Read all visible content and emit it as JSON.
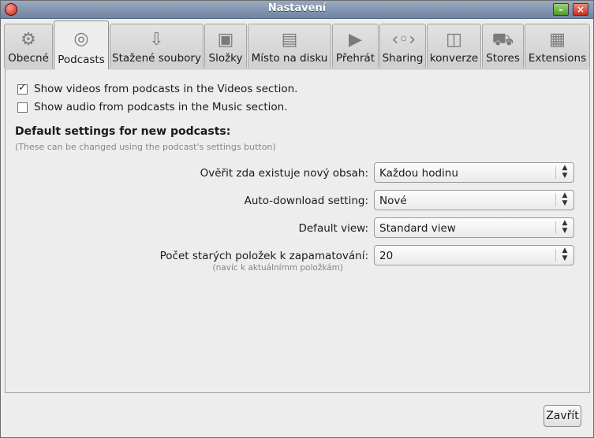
{
  "window": {
    "title": "Nastavení"
  },
  "tabs": [
    {
      "label": "Obecné",
      "icon": "gears-icon",
      "glyph": "⚙"
    },
    {
      "label": "Podcasts",
      "icon": "podcast-icon",
      "glyph": "◎"
    },
    {
      "label": "Stažené soubory",
      "icon": "download-arrow-icon",
      "glyph": "⇩"
    },
    {
      "label": "Složky",
      "icon": "folder-icon",
      "glyph": "▣"
    },
    {
      "label": "Místo na disku",
      "icon": "hard-disk-icon",
      "glyph": "▤"
    },
    {
      "label": "Přehrát",
      "icon": "play-icon",
      "glyph": "▶"
    },
    {
      "label": "Sharing",
      "icon": "sharing-icon",
      "glyph": "‹◦›"
    },
    {
      "label": "konverze",
      "icon": "conversion-book-icon",
      "glyph": "◫"
    },
    {
      "label": "Stores",
      "icon": "shopping-cart-icon",
      "glyph": "⛟"
    },
    {
      "label": "Extensions",
      "icon": "extensions-plugin-icon",
      "glyph": "▦"
    }
  ],
  "active_tab": "Podcasts",
  "options": {
    "videos_label": "Show videos from podcasts in the Videos section.",
    "videos_checked": true,
    "audio_label": "Show audio from podcasts in the Music section.",
    "audio_checked": false
  },
  "defaults": {
    "heading": "Default settings for new podcasts:",
    "hint": "(These can be changed using the podcast's settings button)",
    "check_new_label": "Ověřit zda existuje nový obsah:",
    "check_new_value": "Každou hodinu",
    "auto_download_label": "Auto-download setting:",
    "auto_download_value": "Nové",
    "default_view_label": "Default view:",
    "default_view_value": "Standard view",
    "old_items_label": "Počet starých položek k zapamatování:",
    "old_items_sub": "(navíc k aktuálnímm položkám)",
    "old_items_value": "20"
  },
  "footer": {
    "close_label": "Zavřít"
  }
}
